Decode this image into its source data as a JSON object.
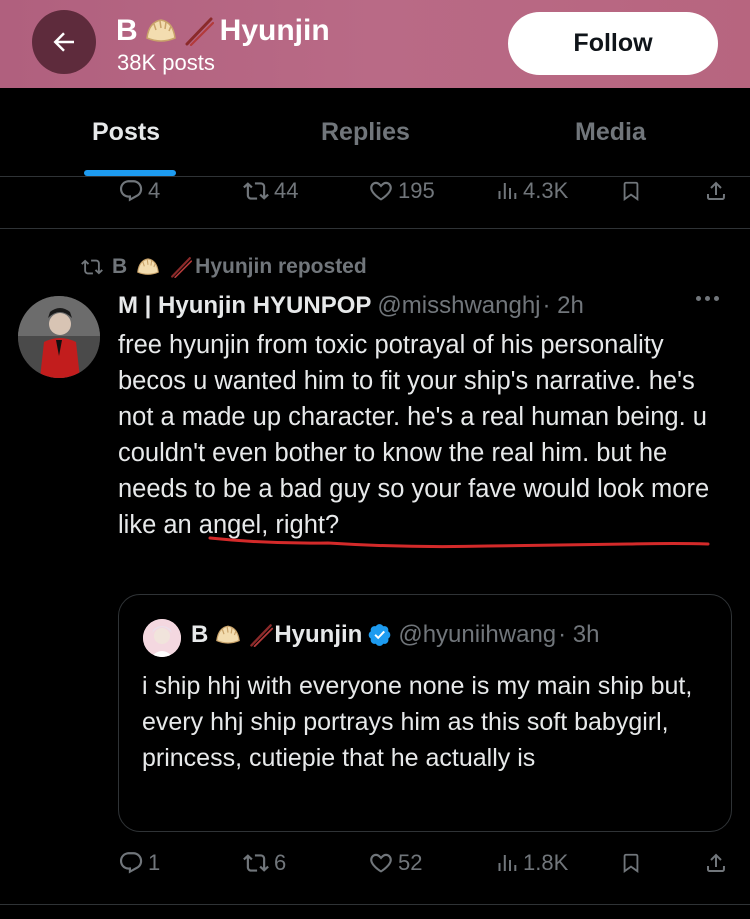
{
  "header": {
    "name_initial": "B",
    "name_suffix": "Hyunjin",
    "post_count": "38K posts",
    "follow_label": "Follow"
  },
  "tabs": [
    {
      "label": "Posts",
      "active": true
    },
    {
      "label": "Replies",
      "active": false
    },
    {
      "label": "Media",
      "active": false
    }
  ],
  "previous_post": {
    "replies": "4",
    "reposts": "44",
    "likes": "195",
    "views": "4.3K"
  },
  "post": {
    "repost_by": "B",
    "repost_by_suffix": "Hyunjin reposted",
    "author": "M | Hyunjin HYUNPOP",
    "handle": "@misshwanghj",
    "time": "· 2h",
    "text": "free hyunjin from toxic potrayal of his personality becos u wanted him to fit your ship's narrative. he's not a made up character. he's a real human being. u couldn't even bother to know the real him. but he needs to be a bad guy so your fave would look more like an angel, right?",
    "quote": {
      "author_initial": "B",
      "author_suffix": "Hyunjin",
      "handle": "@hyuniihwang",
      "time": "· 3h",
      "text": "i ship hhj with everyone none is my main ship but, every hhj ship portrays him as this soft babygirl, princess, cutiepie that he actually is"
    },
    "stats": {
      "replies": "1",
      "reposts": "6",
      "likes": "52",
      "views": "1.8K"
    }
  },
  "colors": {
    "header_bg": "#b7657f",
    "accent": "#1d9bf0",
    "muted": "#71767b",
    "underline_annotation": "#d42a2a"
  },
  "icons": [
    "back-arrow-icon",
    "dumpling-emoji-icon",
    "chopsticks-emoji-icon",
    "reply-icon",
    "repost-icon",
    "like-icon",
    "views-icon",
    "bookmark-icon",
    "share-icon",
    "verified-badge-icon",
    "more-icon"
  ]
}
